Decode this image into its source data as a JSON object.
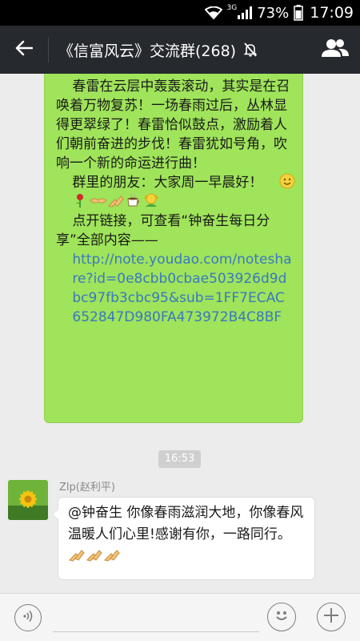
{
  "status_bar": {
    "network": "3G",
    "battery": "73%",
    "time": "17:09"
  },
  "header": {
    "title": "《信富风云》交流群(268)"
  },
  "messages": {
    "outgoing": {
      "line1": "春雷在云层中轰轰滚动，其实是在召唤着万物复苏！一场春雨过后，丛林显得更翠绿了！春雷恰似鼓点，激励着人们朝前奋进的步伐！春雷犹如号角，吹响一个新的命运进行曲！",
      "line2a": "群里的朋友：大家周一早晨好！",
      "line3": "点开链接，可查看“钟奋生每日分享”全部内容——",
      "link": "http://note.youdao.com/noteshare?id=0e8cbb0cbae503926d9dbc97fb3cbc95&sub=1FF7ECAC652847D980FA473972B4C8BF"
    },
    "timestamp": "16:53",
    "incoming": {
      "sender": "Zlp(赵利平)",
      "text": "@钟奋生 你像春雨滋润大地，你像春风温暖人们心里!感谢有你，一路同行。"
    }
  },
  "input": {
    "placeholder": ""
  }
}
